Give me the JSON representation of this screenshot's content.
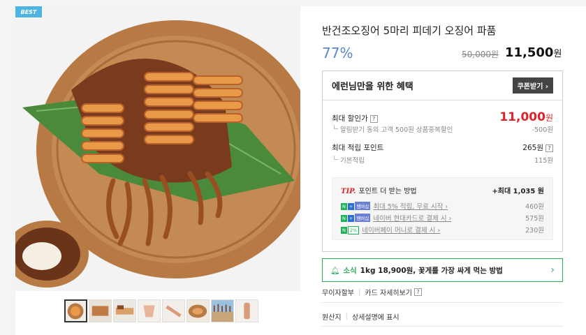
{
  "gallery": {
    "badge": "BEST",
    "thumbnail_count": 8
  },
  "product": {
    "title": "반건조오징어 5마리 피데기 오징어 파품",
    "discount_rate": "77%",
    "original_price": "50,000원",
    "sale_price": "11,500",
    "sale_unit": "원"
  },
  "benefit": {
    "title": "에런님만을 위한 혜택",
    "coupon_button": "쿠폰받기 ›",
    "max_discount_label": "최대 할인가",
    "max_discount_value": "11,000",
    "max_discount_unit": "원",
    "discount_detail": "알림받기 동의 고객 500원 상품중복할인",
    "discount_detail_value": "-500원",
    "max_point_label": "최대 적립 포인트",
    "max_point_value": "265원",
    "base_point_label": "기본적립",
    "base_point_value": "115원",
    "tip": {
      "tag": "TIP.",
      "title": "포인트 더 받는 방법",
      "total": "+최대 1,035 원",
      "items": [
        {
          "badges": [
            "N",
            "+",
            "멤버십"
          ],
          "label": "최대 5% 적립, 무료 시작 ›",
          "value": "460원"
        },
        {
          "badges": [
            "N",
            "+",
            "멤버십"
          ],
          "label": "네이버 현대카드로 결제 시 ›",
          "value": "575원"
        },
        {
          "badges": [
            "N",
            "2%"
          ],
          "label": "네이버페이 머니로 결제 시 ›",
          "value": "230원"
        }
      ]
    }
  },
  "news": {
    "tag": "소식",
    "text": "1kg 18,900원, 꽃게를 가장 싸게 먹는 방법"
  },
  "installment": {
    "label": "무이자할부",
    "link": "카드 자세히보기"
  },
  "origin": {
    "label": "원산지",
    "value": "상세설명에 표시"
  },
  "colors": {
    "accent_red": "#e0232b",
    "accent_green": "#2ca95b",
    "discount_blue": "#5b87c9",
    "best_badge": "#4fb4e2"
  }
}
